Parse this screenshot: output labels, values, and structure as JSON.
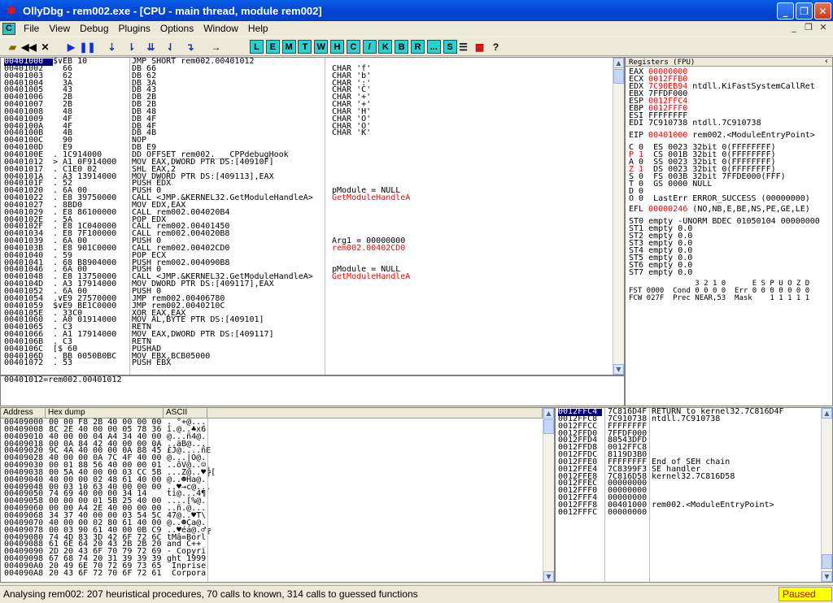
{
  "window": {
    "title": "OllyDbg - rem002.exe - [CPU - main thread, module rem002]"
  },
  "menu": {
    "mdi_label": "C",
    "items": [
      "File",
      "View",
      "Debug",
      "Plugins",
      "Options",
      "Window",
      "Help"
    ]
  },
  "toolbar": {
    "left_buttons": [
      "open-icon",
      "rewind-icon",
      "close-icon",
      "run-icon",
      "pause-icon",
      "step-into-icon",
      "step-over-icon",
      "trace-into-icon",
      "trace-over-icon",
      "execute-till-return-icon",
      "goto-icon"
    ],
    "letters": [
      "L",
      "E",
      "M",
      "T",
      "W",
      "H",
      "C",
      "/",
      "K",
      "B",
      "R",
      "...",
      "S"
    ],
    "right_buttons": [
      "list-icon",
      "colors-icon",
      "help-icon"
    ]
  },
  "disasm": {
    "addr": [
      "00401000",
      "00401002",
      "00401003",
      "00401004",
      "00401005",
      "00401006",
      "00401007",
      "00401008",
      "00401009",
      "0040100A",
      "0040100B",
      "0040100C",
      "0040100D",
      "0040100E",
      "00401012",
      "00401017",
      "0040101A",
      "0040101F",
      "00401020",
      "00401022",
      "00401027",
      "00401029",
      "0040102E",
      "0040102F",
      "00401034",
      "00401039",
      "0040103B",
      "00401040",
      "00401041",
      "00401046",
      "00401048",
      "0040104D",
      "00401052",
      "00401054",
      "00401059",
      "0040105E",
      "00401060",
      "00401065",
      "00401066",
      "0040106B",
      "0040106C",
      "0040106D",
      "00401072"
    ],
    "hex": [
      "$∨EB 10",
      "  66",
      "  62",
      "  3A",
      "  43",
      "  2B",
      "  2B",
      "  48",
      "  4F",
      "  4F",
      "  4B",
      "  90",
      "  E9",
      ". 1C914000",
      "> A1 0F914000",
      ". C1E0 02",
      ". A3 13914000",
      ". 52",
      ". 6A 00",
      ". E8 39750000",
      ". 8BD0",
      ". E8 86100000",
      ". 5A",
      ". E8 1C040000",
      ". E8 7F100000",
      ". 6A 00",
      ". E8 901C0000",
      ". 59",
      ". 68 B8904000",
      ". 6A 00",
      ". E8 13750000",
      ". A3 17914000",
      ". 6A 00",
      ".∨E9 27570000",
      "$∨E9 BE1C0000",
      ". 33C0",
      ". A0 01914000",
      ". C3",
      ". A1 17914000",
      ". C3",
      "[$ 60",
      ". BB 0050B0BC",
      ". 53"
    ],
    "asm": [
      "JMP SHORT rem002.00401012",
      "DB 66",
      "DB 62",
      "DB 3A",
      "DB 43",
      "DB 2B",
      "DB 2B",
      "DB 48",
      "DB 4F",
      "DB 4F",
      "DB 4B",
      "NOP",
      "DB E9",
      "DD OFFSET rem002.___CPPdebugHook",
      "MOV EAX,DWORD PTR DS:[40910F]",
      "SHL EAX,2",
      "MOV DWORD PTR DS:[409113],EAX",
      "PUSH EDX",
      "PUSH 0",
      "CALL <JMP.&KERNEL32.GetModuleHandleA>",
      "MOV EDX,EAX",
      "CALL rem002.004020B4",
      "POP EDX",
      "CALL rem002.00401450",
      "CALL rem002.004020B8",
      "PUSH 0",
      "CALL rem002.00402CD0",
      "POP ECX",
      "PUSH rem002.004090B8",
      "PUSH 0",
      "CALL <JMP.&KERNEL32.GetModuleHandleA>",
      "MOV DWORD PTR DS:[409117],EAX",
      "PUSH 0",
      "JMP rem002.00406780",
      "JMP rem002.0040210C",
      "XOR EAX,EAX",
      "MOV AL,BYTE PTR DS:[409101]",
      "RETN",
      "MOV EAX,DWORD PTR DS:[409117]",
      "RETN",
      "PUSHAD",
      "MOV EBX,BCB05000",
      "PUSH EBX"
    ],
    "comments": [
      "",
      "CHAR 'f'",
      "CHAR 'b'",
      "CHAR ':'",
      "CHAR 'C'",
      "CHAR '+'",
      "CHAR '+'",
      "CHAR 'H'",
      "CHAR 'O'",
      "CHAR 'O'",
      "CHAR 'K'",
      "",
      "",
      "",
      "",
      "",
      "",
      "",
      "pModule = NULL",
      "GetModuleHandleA",
      "",
      "",
      "",
      "",
      "",
      "Arg1 = 00000000",
      "rem002.00402CD0",
      "",
      "",
      "pModule = NULL",
      "GetModuleHandleA",
      "",
      "",
      "",
      "",
      "",
      "",
      "",
      "",
      "",
      "",
      "",
      ""
    ],
    "info": "00401012=rem002.00401012"
  },
  "registers": {
    "title": "Registers (FPU)",
    "lines": [
      {
        "n": "EAX",
        "v": "00000000",
        "c": "",
        "red": true
      },
      {
        "n": "ECX",
        "v": "0012FFB0",
        "c": "",
        "red": true
      },
      {
        "n": "EDX",
        "v": "7C90EB94",
        "c": "ntdll.KiFastSystemCallRet",
        "red": true
      },
      {
        "n": "EBX",
        "v": "7FFDF000",
        "c": "",
        "red": false
      },
      {
        "n": "ESP",
        "v": "0012FFC4",
        "c": "",
        "red": true
      },
      {
        "n": "EBP",
        "v": "0012FFF0",
        "c": "",
        "red": true
      },
      {
        "n": "ESI",
        "v": "FFFFFFFF",
        "c": "",
        "red": false
      },
      {
        "n": "EDI",
        "v": "7C910738",
        "c": "ntdll.7C910738",
        "red": false
      }
    ],
    "eip": {
      "n": "EIP",
      "v": "00401000",
      "c": "rem002.<ModuleEntryPoint>"
    },
    "flags": [
      [
        "C 0",
        "ES 0023 32bit 0(FFFFFFFF)"
      ],
      [
        "P 1",
        "CS 001B 32bit 0(FFFFFFFF)"
      ],
      [
        "A 0",
        "SS 0023 32bit 0(FFFFFFFF)"
      ],
      [
        "Z 1",
        "DS 0023 32bit 0(FFFFFFFF)"
      ],
      [
        "S 0",
        "FS 003B 32bit 7FFDE000(FFF)"
      ],
      [
        "T 0",
        "GS 0000 NULL"
      ],
      [
        "D 0",
        ""
      ],
      [
        "O 0",
        "LastErr ERROR_SUCCESS (00000000)"
      ]
    ],
    "efl": {
      "n": "EFL",
      "v": "00000246",
      "c": "(NO,NB,E,BE,NS,PE,GE,LE)"
    },
    "fpu": [
      "ST0 empty -UNORM BDEC 01050104 00000000",
      "ST1 empty 0.0",
      "ST2 empty 0.0",
      "ST3 empty 0.0",
      "ST4 empty 0.0",
      "ST5 empty 0.0",
      "ST6 empty 0.0",
      "ST7 empty 0.0"
    ],
    "fpu_tail": [
      "               3 2 1 0      E S P U O Z D",
      "FST 0000  Cond 0 0 0 0  Err 0 0 0 0 0 0 0",
      "FCW 027F  Prec NEAR,53  Mask    1 1 1 1 1"
    ]
  },
  "dump": {
    "headers": [
      "Address",
      "Hex dump",
      "ASCII"
    ],
    "addr": [
      "00409000",
      "00409008",
      "00409010",
      "00409018",
      "00409020",
      "00409028",
      "00409030",
      "00409038",
      "00409040",
      "00409048",
      "00409050",
      "00409058",
      "00409060",
      "00409068",
      "00409070",
      "00409078",
      "00409080",
      "00409088",
      "00409090",
      "00409098",
      "004090A0",
      "004090A8"
    ],
    "hex": [
      "00 00 F8 2B 40 00 00 00",
      "8C 2E 40 00 00 05 78 36",
      "40 00 00 04 A4 34 40 00",
      "00 0A 84 42 40 00 00 0A",
      "9C 4A 40 00 00 0A 88 45",
      "40 00 00 0A 7C 4F 40 00",
      "00 01 88 56 40 00 00 01",
      "00 5A 40 00 00 03 CC 5B",
      "40 00 00 02 48 61 40 00",
      "00 03 10 63 40 00 00 00",
      "74 69 40 00 00 34 14",
      "00 00 00 01 5B 25 40 00",
      "00 00 A4 2E 40 00 00 00",
      "34 37 40 00 00 03 54 5C",
      "40 00 00 02 80 61 40 00",
      "00 03 90 61 40 00 0B C9",
      "74 4D 83 3D 42 6F 72 6C",
      "61 6E 64 20 43 2B 2B 20",
      "2D 20 43 6F 70 79 72 69",
      "67 68 74 20 31 39 39 39",
      "20 49 6E 70 72 69 73 65",
      "20 43 6F 72 70 6F 72 61"
    ],
    "ascii": [
      ". °+@...",
      "î.@..♣x6",
      "@...ñ4@.",
      "..äB@...",
      "£J@....ñE",
      "@...|O@.",
      "..ôV@..☺",
      "...Z@..♥╠[",
      "@..☻Ha@.",
      "..♥→c@...",
      "ti@...4¶",
      "....[%@.",
      "..ñ.@...",
      "47@..♥T\\",
      "@..☻Ça@.",
      "..♥éa@.♂╔",
      "tMâ=Borl",
      "and C++ ",
      "- Copyri",
      "ght 1999",
      " Inprise",
      " Corpora"
    ]
  },
  "stack": {
    "addr": [
      "0012FFC4",
      "0012FFC8",
      "0012FFCC",
      "0012FFD0",
      "0012FFD4",
      "0012FFD8",
      "0012FFDC",
      "0012FFE0",
      "0012FFE4",
      "0012FFE8",
      "0012FFEC",
      "0012FFF0",
      "0012FFF4",
      "0012FFF8",
      "0012FFFC"
    ],
    "val": [
      "7C816D4F",
      "7C910738",
      "FFFFFFFF",
      "7FFDF000",
      "80543DFD",
      "0012FFC8",
      "8119D3B0",
      "FFFFFFFF",
      "7C8399F3",
      "7C816D58",
      "00000000",
      "00000000",
      "00000000",
      "00401000",
      "00000000"
    ],
    "cmt": [
      "RETURN to kernel32.7C816D4F",
      "ntdll.7C910738",
      "",
      "",
      "",
      "",
      "",
      "End of SEH chain",
      "SE handler",
      "kernel32.7C816D58",
      "",
      "",
      "",
      "rem002.<ModuleEntryPoint>",
      ""
    ]
  },
  "status": {
    "message": "Analysing rem002: 207 heuristical procedures, 70 calls to known, 314 calls to guessed functions",
    "state": "Paused"
  },
  "colors": {
    "red": "#ff0000",
    "selection": "#000080",
    "paused_bg": "#ffff00"
  }
}
